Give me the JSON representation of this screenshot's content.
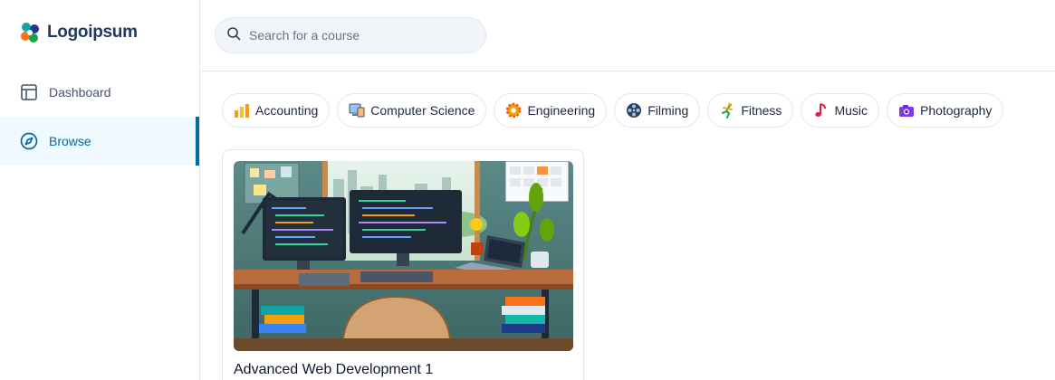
{
  "brand": {
    "name": "Logoipsum"
  },
  "sidebar": {
    "items": [
      {
        "label": "Dashboard",
        "icon": "layout-icon",
        "active": false
      },
      {
        "label": "Browse",
        "icon": "compass-icon",
        "active": true
      }
    ]
  },
  "search": {
    "placeholder": "Search for a course",
    "value": ""
  },
  "categories": [
    {
      "label": "Accounting",
      "icon": "bar-chart-icon"
    },
    {
      "label": "Computer Science",
      "icon": "computer-icon"
    },
    {
      "label": "Engineering",
      "icon": "gear-icon"
    },
    {
      "label": "Filming",
      "icon": "film-reel-icon"
    },
    {
      "label": "Fitness",
      "icon": "runner-icon"
    },
    {
      "label": "Music",
      "icon": "music-note-icon"
    },
    {
      "label": "Photography",
      "icon": "camera-icon"
    }
  ],
  "courses": [
    {
      "title": "Advanced Web Development 1",
      "thumbnail": "desk-workspace-illustration"
    }
  ],
  "colors": {
    "accent": "#0369a1",
    "active_bg": "#f0f9ff",
    "border": "#e2e8f0"
  }
}
